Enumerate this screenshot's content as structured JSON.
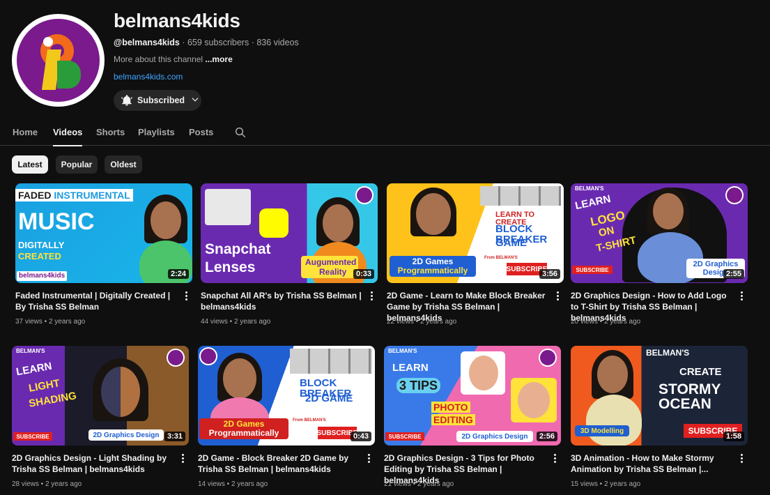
{
  "channel": {
    "name": "belmans4kids",
    "handle": "@belmans4kids",
    "stats": " · 659 subscribers · 836 videos",
    "about": "More about this channel ",
    "about_more": "...more",
    "link": "belmans4kids.com",
    "subscribe_label": "Subscribed"
  },
  "tabs": [
    "Home",
    "Videos",
    "Shorts",
    "Playlists",
    "Posts"
  ],
  "active_tab": "Videos",
  "chips": [
    "Latest",
    "Popular",
    "Oldest"
  ],
  "active_chip": "Latest",
  "videos": [
    {
      "title": "Faded Instrumental | Digitally Created | By Trisha SS Belman",
      "views": "37 views",
      "age": "2 years ago",
      "duration": "2:24",
      "thumb_text": [
        "FADED ",
        "INSTRUMENTAL",
        "MUSIC",
        "DIGITALLY",
        "CREATED",
        "belmans4kids"
      ]
    },
    {
      "title": "Snapchat All AR's by Trisha SS Belman | belmans4kids",
      "views": "44 views",
      "age": "2 years ago",
      "duration": "0:33",
      "thumb_text": [
        "Snapchat",
        "Lenses",
        "Augumented",
        "Reality"
      ]
    },
    {
      "title": "2D Game - Learn to Make Block Breaker Game by Trisha SS Belman | belmans4kids",
      "views": "22 views",
      "age": "2 years ago",
      "duration": "3:56",
      "thumb_text": [
        "LEARN TO CREATE",
        "BLOCK BREAKER",
        "GAME",
        "2D Games",
        "Programmatically",
        "SUBSCRIBE",
        "From BELMAN'S"
      ]
    },
    {
      "title": "2D Graphics Design - How to Add Logo to T-Shirt by Trisha SS Belman | belmans4kids",
      "views": "20 views",
      "age": "2 years ago",
      "duration": "2:55",
      "thumb_text": [
        "BELMAN'S",
        "LEARN",
        "LOGO",
        "ON",
        "T-SHIRT",
        "SUBSCRIBE",
        "2D Graphics",
        "Design"
      ]
    },
    {
      "title": "2D Graphics Design - Light Shading by Trisha SS Belman | belmans4kids",
      "views": "28 views",
      "age": "2 years ago",
      "duration": "3:31",
      "thumb_text": [
        "BELMAN'S",
        "LEARN",
        "LIGHT",
        "SHADING",
        "SUBSCRIBE",
        "2D Graphics Design"
      ]
    },
    {
      "title": "2D Game - Block Breaker 2D Game by Trisha SS Belman | belmans4kids",
      "views": "14 views",
      "age": "2 years ago",
      "duration": "0:43",
      "thumb_text": [
        "BLOCK BREAKER",
        "2D GAME",
        "2D Games",
        "Programmatically",
        "SUBSCRIBE",
        "From BELMAN'S"
      ]
    },
    {
      "title": "2D Graphics Design - 3 Tips for Photo Editing by Trisha SS Belman | belmans4kids",
      "views": "21 views",
      "age": "2 years ago",
      "duration": "2:56",
      "thumb_text": [
        "BELMAN'S",
        "LEARN",
        "3 TIPS",
        "PHOTO",
        "EDITING",
        "SUBSCRIBE",
        "2D Graphics Design"
      ]
    },
    {
      "title": "3D Animation - How to Make Stormy Animation by Trisha SS Belman |...",
      "views": "15 views",
      "age": "2 years ago",
      "duration": "1:58",
      "thumb_text": [
        "BELMAN'S",
        "CREATE",
        "STORMY OCEAN",
        "3D Modelling",
        "SUBSCRIBE"
      ]
    }
  ],
  "colors": {
    "background": "#0f0f0f",
    "link": "#3ea6ff",
    "chip": "#272727",
    "chip_active": "#f1f1f1",
    "muted": "#aaaaaa"
  },
  "icons": [
    "bell-icon",
    "chevron-down-icon",
    "search-icon",
    "more-vert-icon"
  ]
}
